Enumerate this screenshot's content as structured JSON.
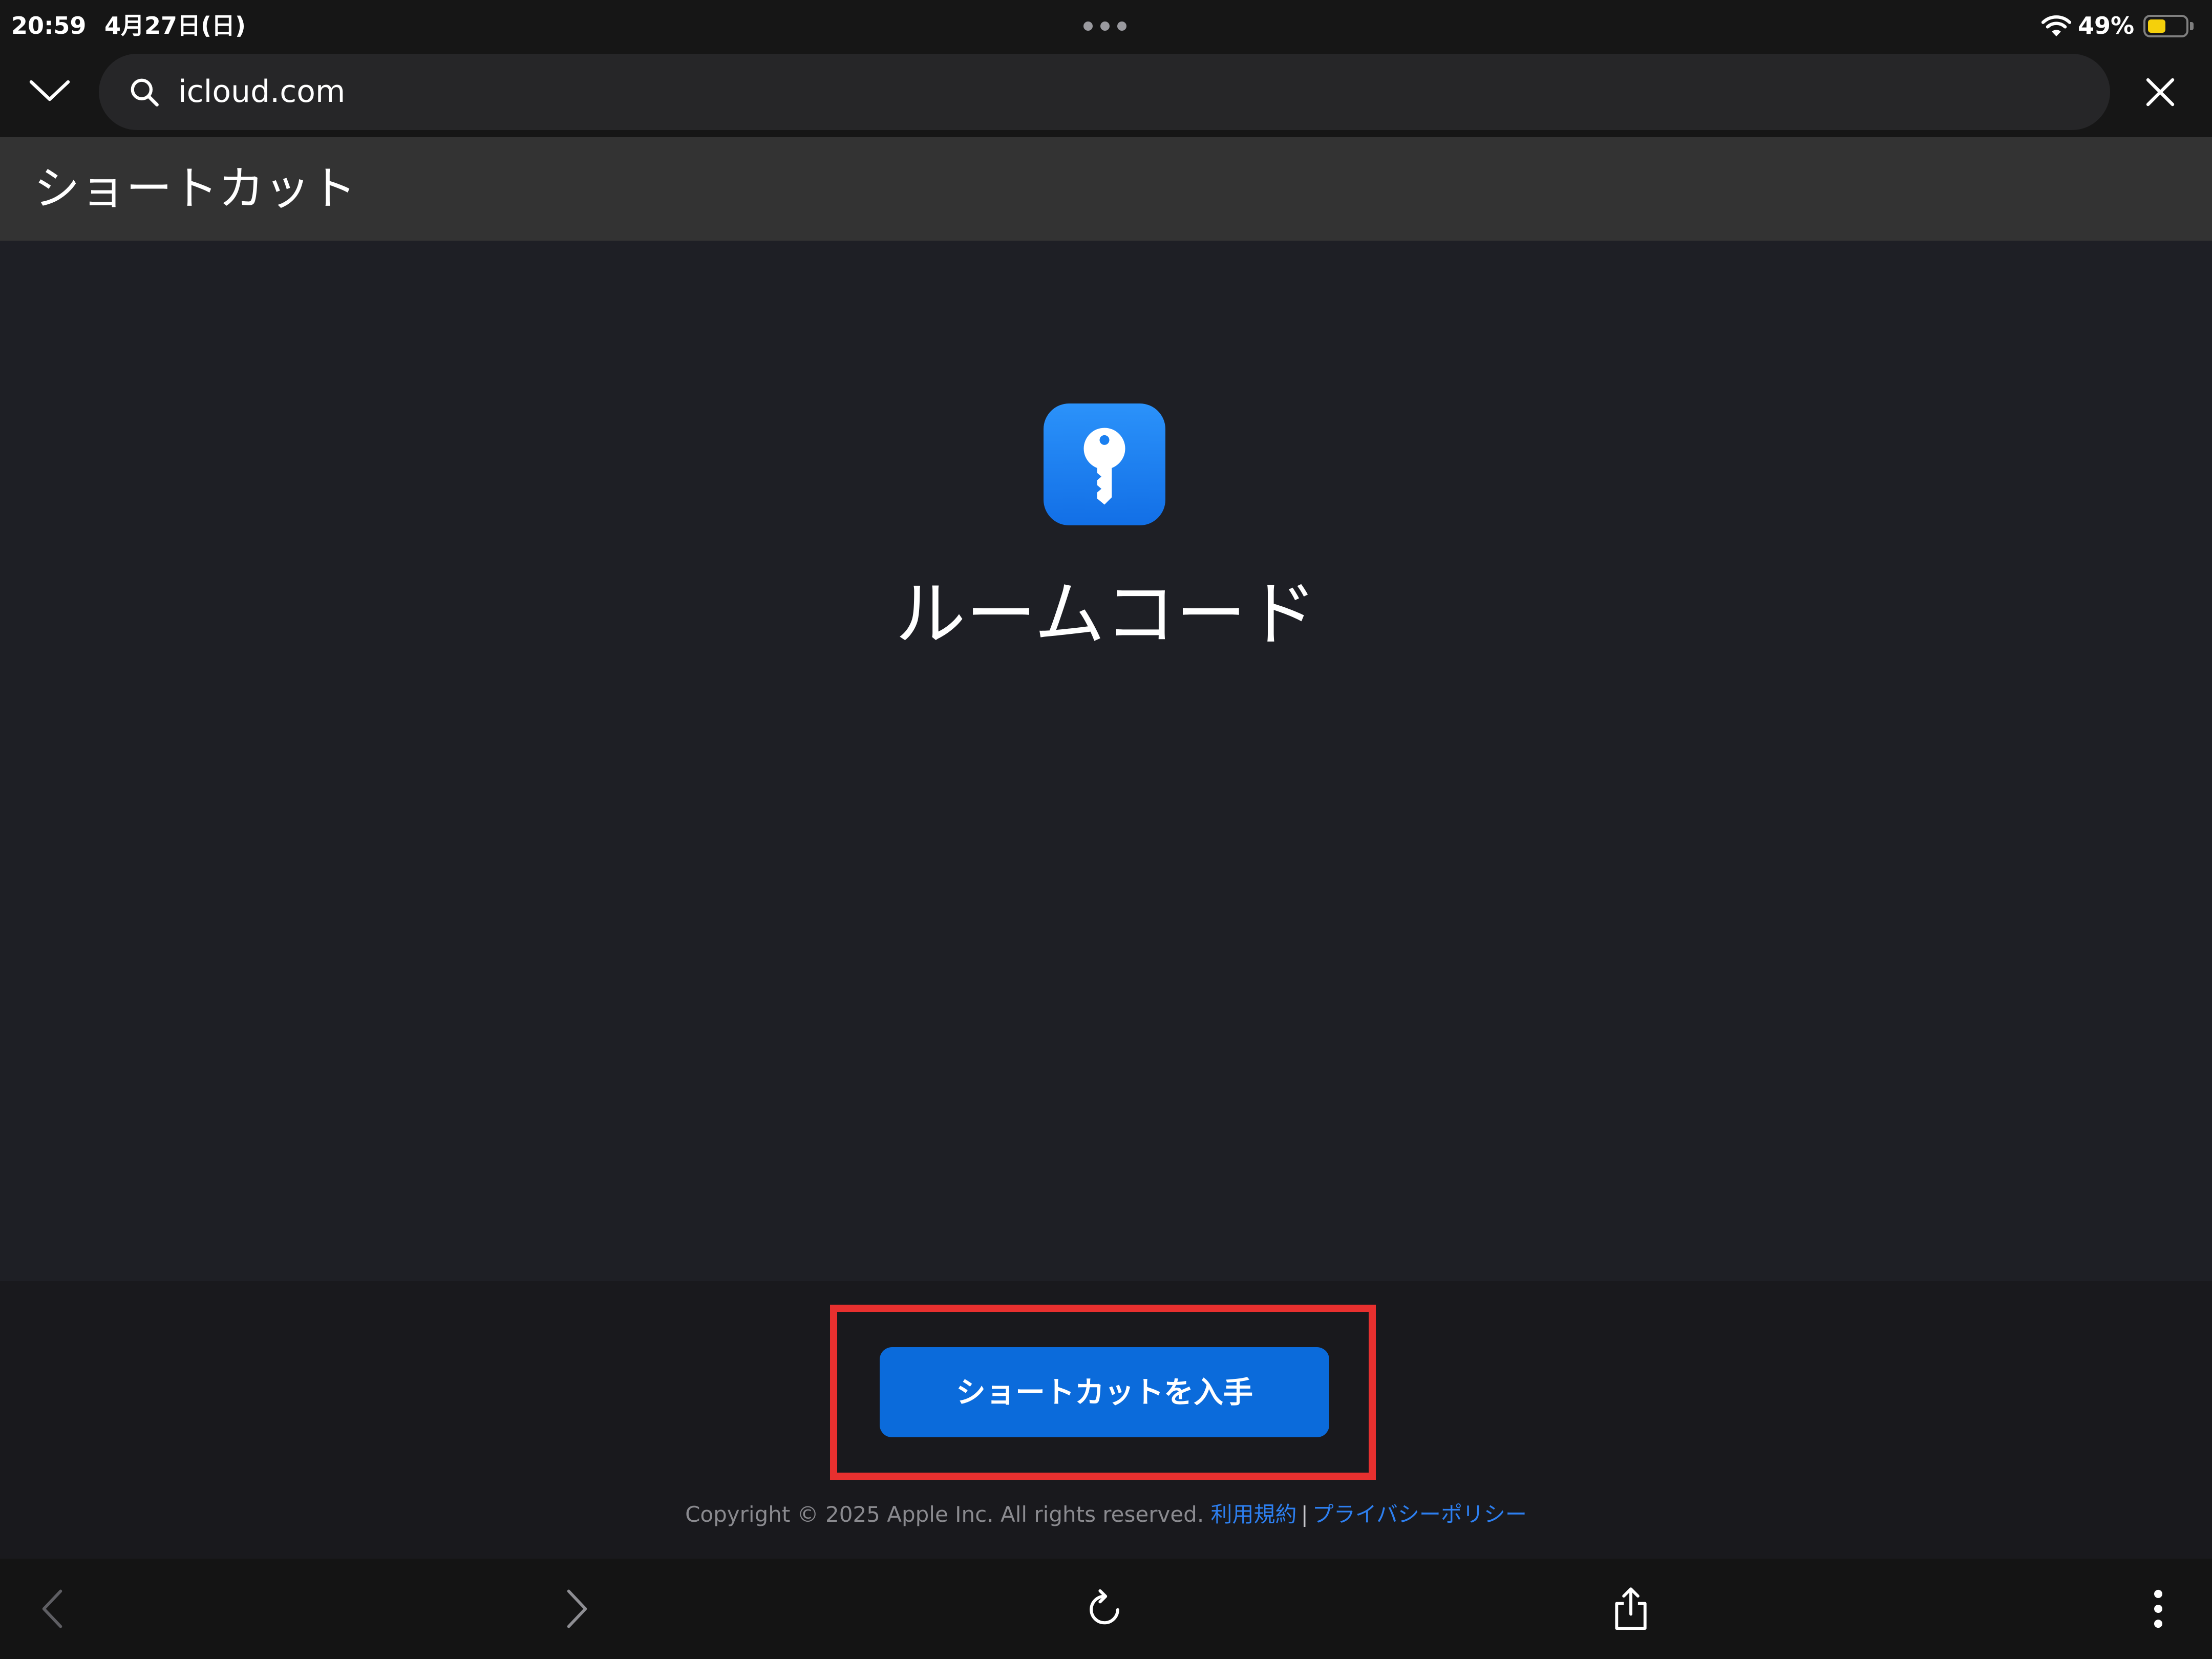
{
  "status_bar": {
    "time": "20:59",
    "date": "4月27日(日)",
    "battery_percent": "49%",
    "battery_level": 0.49
  },
  "url_bar": {
    "url": "icloud.com"
  },
  "page_header": {
    "title": "ショートカット"
  },
  "shortcut": {
    "name": "ルームコード",
    "icon": "key-icon"
  },
  "actions": {
    "get_shortcut_label": "ショートカットを入手"
  },
  "footer": {
    "copyright": "Copyright © 2025 Apple Inc. All rights reserved.",
    "terms_link": "利用規約",
    "separator": "|",
    "privacy_link": "プライバシーポリシー"
  },
  "icons": {
    "multitask": "more-horizontal-icon",
    "wifi": "wifi-icon",
    "battery": "battery-icon",
    "collapse": "chevron-down-icon",
    "search": "search-icon",
    "close": "close-icon",
    "back": "chevron-left-icon",
    "forward": "chevron-right-icon",
    "reload": "reload-icon",
    "share": "share-icon",
    "more": "more-vertical-icon"
  },
  "colors": {
    "accent": "#0b6bdb",
    "highlight": "#e8302f",
    "link": "#2d7ff0",
    "battery": "#f5d00b",
    "app_icon": "#1a7ff0"
  }
}
